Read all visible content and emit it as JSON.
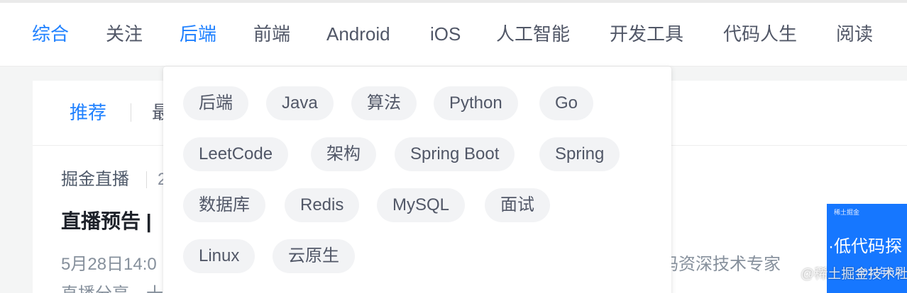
{
  "nav": {
    "items": [
      "综合",
      "关注",
      "后端",
      "前端",
      "Android",
      "iOS",
      "人工智能",
      "开发工具",
      "代码人生",
      "阅读"
    ],
    "active": "后端"
  },
  "subnav": {
    "active_tab": "推荐",
    "second_tab": "最"
  },
  "feed": {
    "author": "掘金直播",
    "time": "2",
    "title": "直播预告 |",
    "abstract": "5月28日14:0",
    "abstract_right": "码资深技术专家",
    "abstract_2": "直播分享，十"
  },
  "thumbnail": {
    "brand": "稀土掘金",
    "title": "·低代码探",
    "date": "2022年5月"
  },
  "watermark": "@稀土掘金技术社区",
  "dropdown": {
    "tags": [
      [
        "后端",
        "Java",
        "算法",
        "Python",
        "Go"
      ],
      [
        "LeetCode",
        "架构",
        "Spring Boot",
        "Spring"
      ],
      [
        "数据库",
        "Redis",
        "MySQL",
        "面试"
      ],
      [
        "Linux",
        "云原生"
      ]
    ]
  },
  "colors": {
    "accent": "#1e80ff",
    "text": "#515767",
    "tag_bg": "#f2f3f5"
  }
}
